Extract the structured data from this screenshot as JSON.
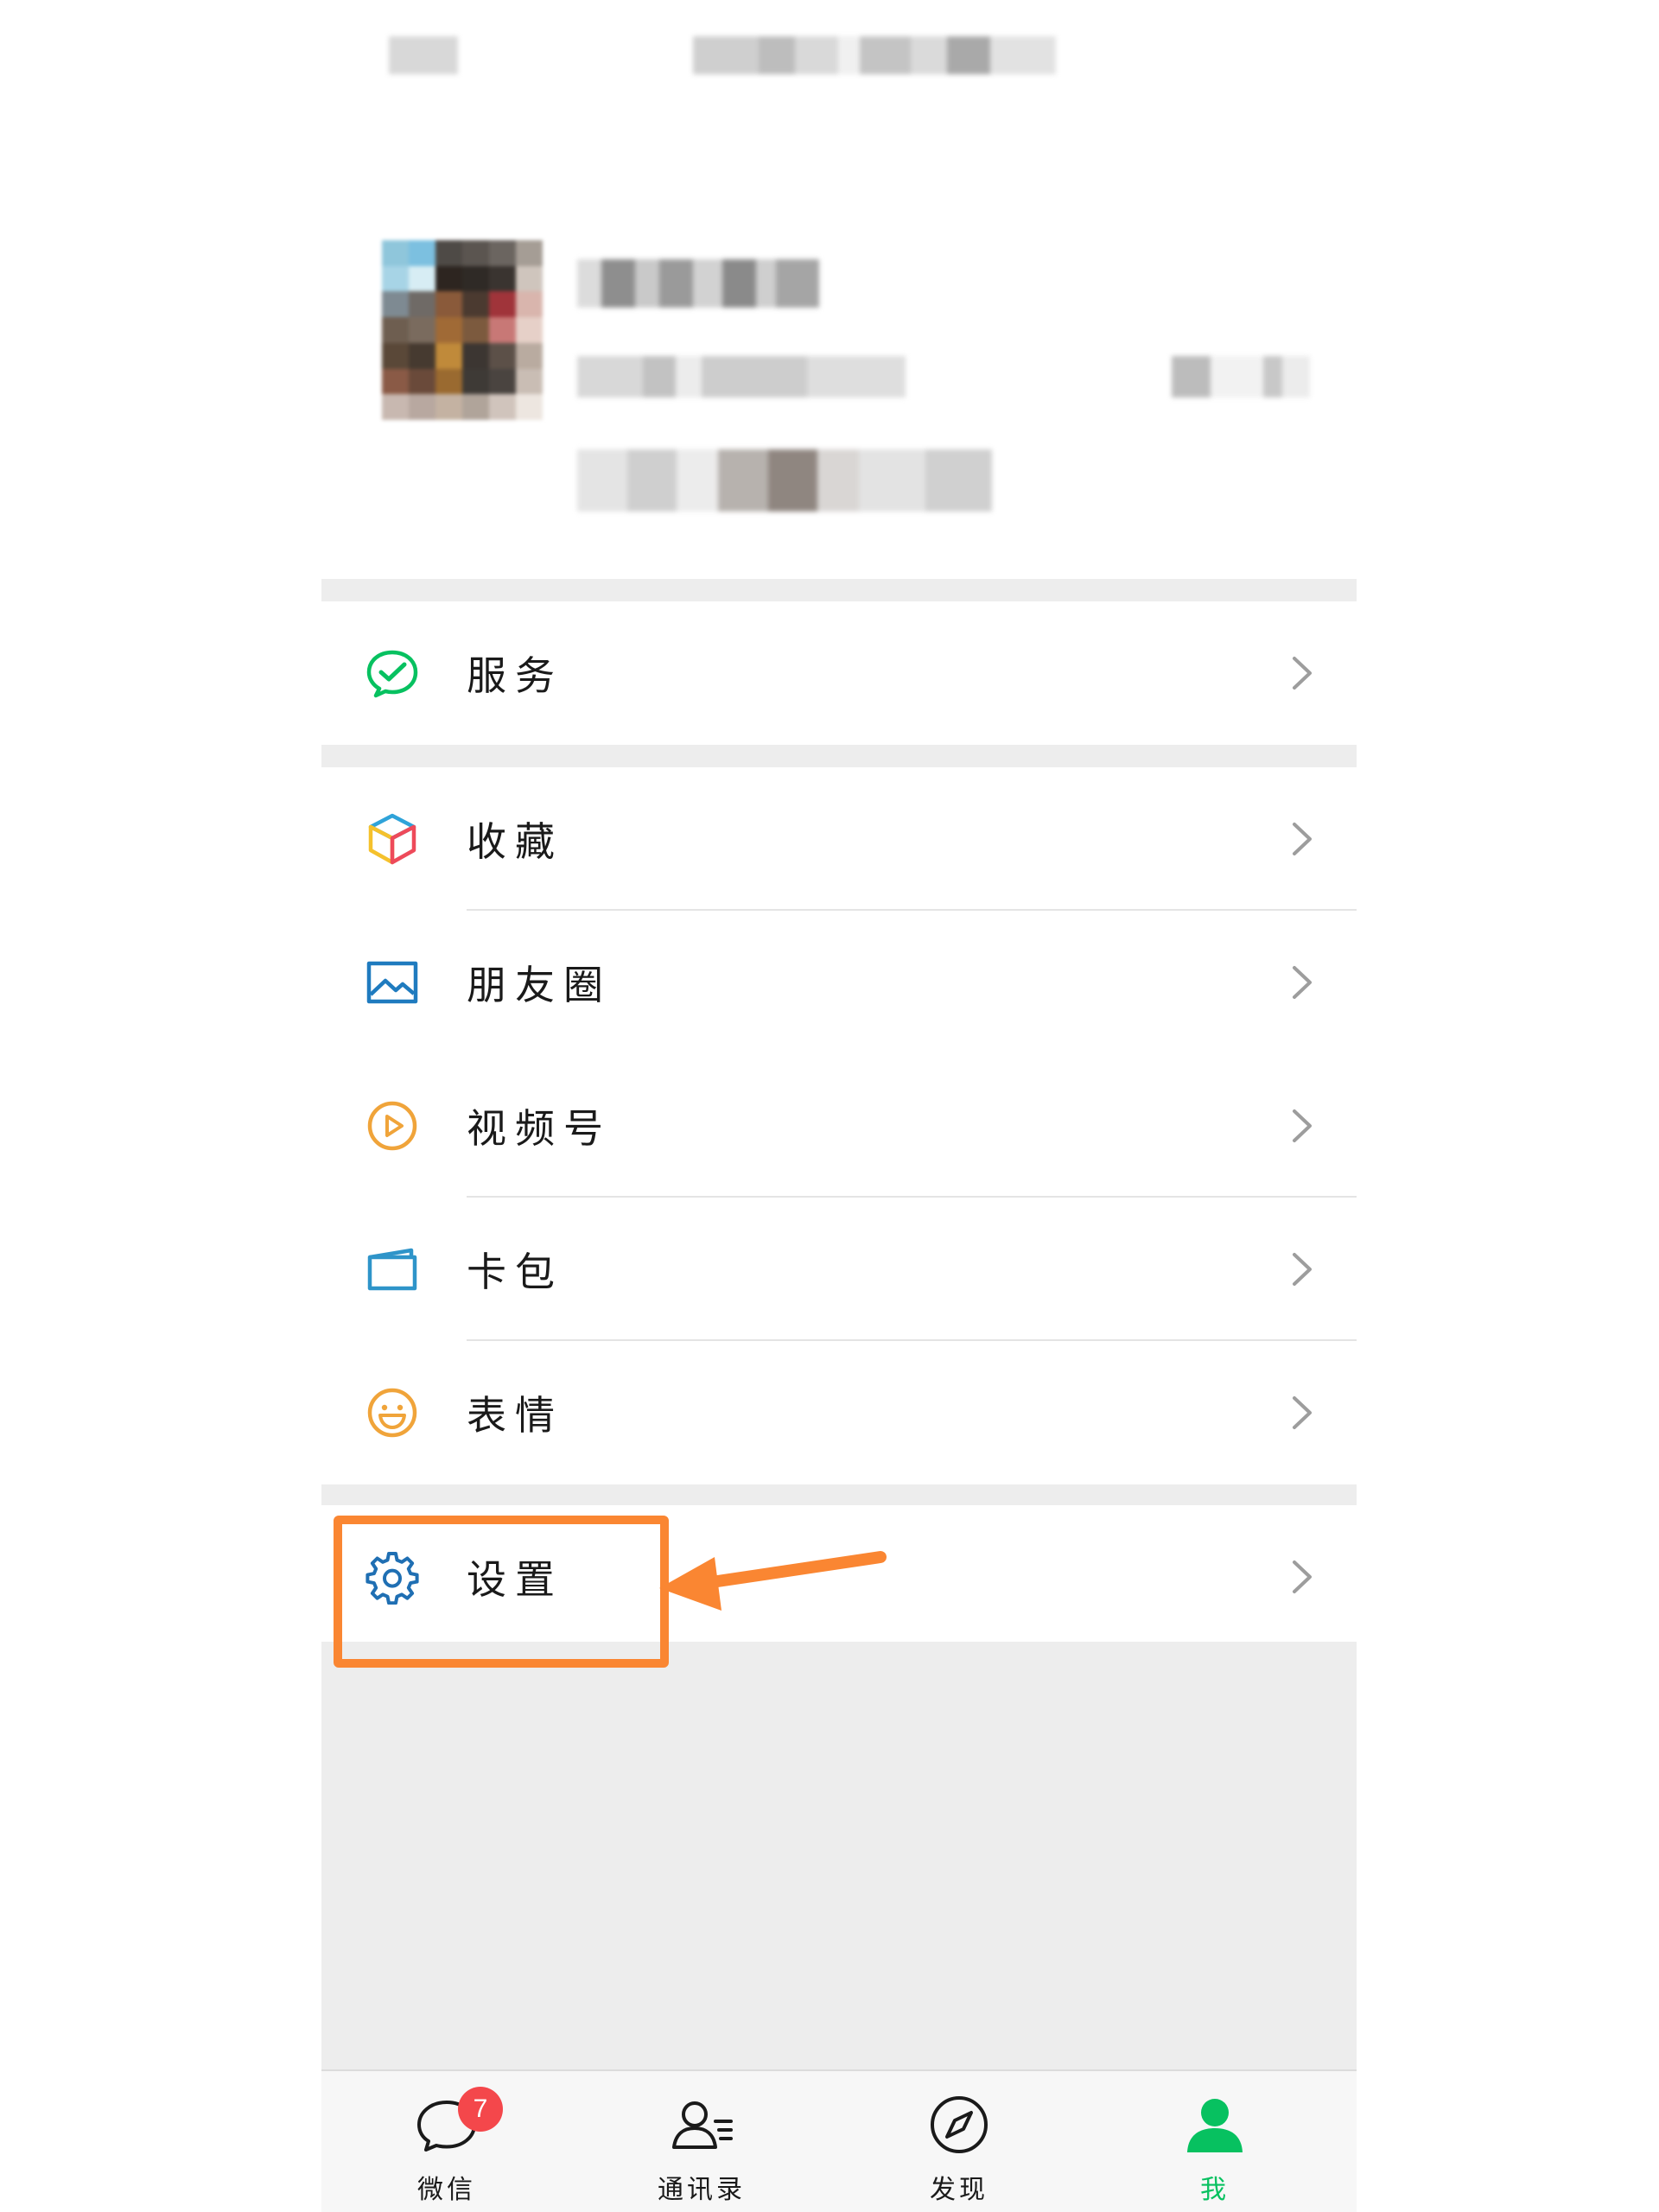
{
  "colors": {
    "accent_green": "#07c160",
    "highlight_orange": "#fa8632",
    "badge_red": "#f4474b",
    "background_gray": "#ededed"
  },
  "menu_groups": [
    [
      {
        "id": "services",
        "label": "服务",
        "icon": "wechat-pay-icon"
      }
    ],
    [
      {
        "id": "favorites",
        "label": "收藏",
        "icon": "cube-icon"
      },
      {
        "id": "moments",
        "label": "朋友圈",
        "icon": "image-icon"
      },
      {
        "id": "channels",
        "label": "视频号",
        "icon": "play-icon"
      },
      {
        "id": "card-wallet",
        "label": "卡包",
        "icon": "card-wallet-icon"
      },
      {
        "id": "stickers",
        "label": "表情",
        "icon": "smiley-icon"
      }
    ],
    [
      {
        "id": "settings",
        "label": "设置",
        "icon": "gear-icon",
        "highlighted": true
      }
    ]
  ],
  "tabbar": [
    {
      "id": "chats",
      "label": "微信",
      "icon": "chat-bubble-icon",
      "badge": "7",
      "active": false
    },
    {
      "id": "contacts",
      "label": "通讯录",
      "icon": "contacts-icon",
      "active": false
    },
    {
      "id": "discover",
      "label": "发现",
      "icon": "compass-icon",
      "active": false
    },
    {
      "id": "me",
      "label": "我",
      "icon": "person-icon",
      "active": true
    }
  ]
}
